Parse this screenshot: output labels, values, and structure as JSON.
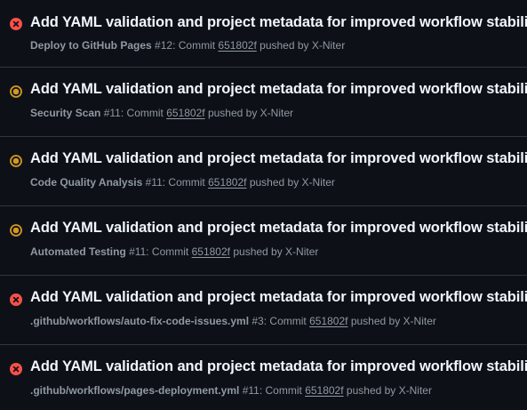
{
  "runs": [
    {
      "status": "failure",
      "title": "Add YAML validation and project metadata for improved workflow stability",
      "workflow": "Deploy to GitHub Pages",
      "run_number": "#12",
      "commit_prefix": ": Commit",
      "sha": "651802f",
      "pushed_by": "pushed by X-Niter"
    },
    {
      "status": "in_progress",
      "title": "Add YAML validation and project metadata for improved workflow stability",
      "workflow": "Security Scan",
      "run_number": "#11",
      "commit_prefix": ": Commit",
      "sha": "651802f",
      "pushed_by": "pushed by X-Niter"
    },
    {
      "status": "in_progress",
      "title": "Add YAML validation and project metadata for improved workflow stability",
      "workflow": "Code Quality Analysis",
      "run_number": "#11",
      "commit_prefix": ": Commit",
      "sha": "651802f",
      "pushed_by": "pushed by X-Niter"
    },
    {
      "status": "in_progress",
      "title": "Add YAML validation and project metadata for improved workflow stability",
      "workflow": "Automated Testing",
      "run_number": "#11",
      "commit_prefix": ": Commit",
      "sha": "651802f",
      "pushed_by": "pushed by X-Niter"
    },
    {
      "status": "failure",
      "title": "Add YAML validation and project metadata for improved workflow stability",
      "workflow": ".github/workflows/auto-fix-code-issues.yml",
      "run_number": "#3",
      "commit_prefix": ": Commit",
      "sha": "651802f",
      "pushed_by": "pushed by X-Niter"
    },
    {
      "status": "failure",
      "title": "Add YAML validation and project metadata for improved workflow stability",
      "workflow": ".github/workflows/pages-deployment.yml",
      "run_number": "#11",
      "commit_prefix": ": Commit",
      "sha": "651802f",
      "pushed_by": "pushed by X-Niter"
    }
  ],
  "colors": {
    "failure": "#f85149",
    "in_progress": "#d29922",
    "background": "#0d1117",
    "divider": "#30363d"
  },
  "icons": {
    "failure": "x-circle-fill-icon",
    "in_progress": "dot-fill-in-progress-icon"
  }
}
